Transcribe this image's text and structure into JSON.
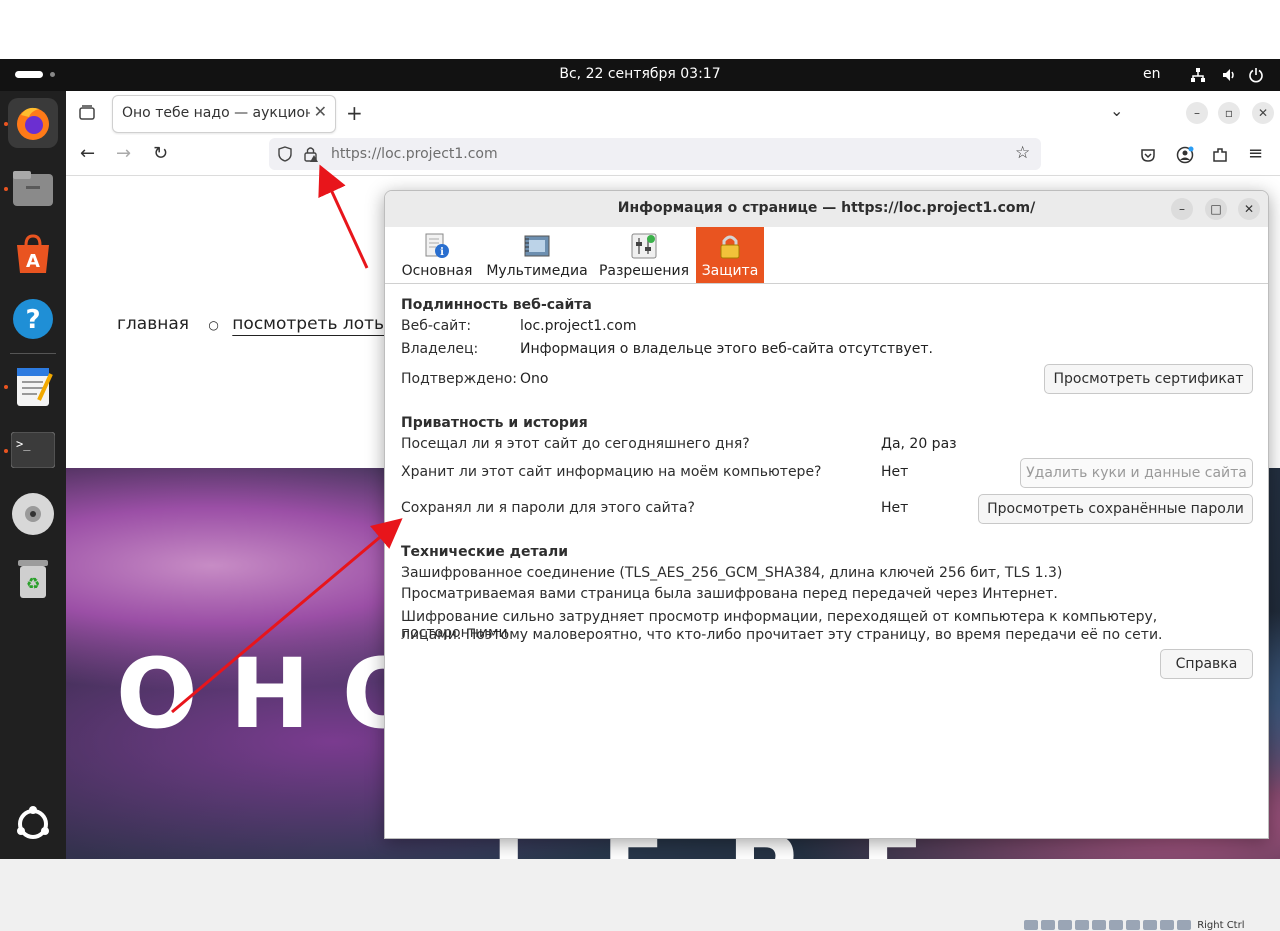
{
  "system": {
    "clock": "Вс, 22 сентября  03:17",
    "language": "en"
  },
  "dock": {
    "items": [
      "firefox",
      "files",
      "app-center",
      "help",
      "text-editor",
      "terminal",
      "optical-drive",
      "trash",
      "show-apps"
    ]
  },
  "browser": {
    "tab_title": "Оно тебе надо — аукцион в",
    "url": "https://loc.project1.com"
  },
  "page": {
    "nav": {
      "home": "главная",
      "lots": "посмотреть лоты"
    },
    "hero_title": "ОНО",
    "hero_subtitle": "ТЕБЕ"
  },
  "dialog": {
    "title": "Информация о странице — https://loc.project1.com/",
    "tabs": [
      "Основная",
      "Мультимедиа",
      "Разрешения",
      "Защита"
    ],
    "active_tab": "Защита",
    "identity": {
      "heading": "Подлинность веб-сайта",
      "website_label": "Веб-сайт:",
      "website_value": "loc.project1.com",
      "owner_label": "Владелец:",
      "owner_value": "Информация о владельце этого веб-сайта отсутствует.",
      "verified_label": "Подтверждено:",
      "verified_value": "Ono",
      "view_cert_button": "Просмотреть сертификат"
    },
    "privacy": {
      "heading": "Приватность и история",
      "visited_q": "Посещал ли я этот сайт до сегодняшнего дня?",
      "visited_a": "Да, 20 раз",
      "stores_q": "Хранит ли этот сайт информацию на моём компьютере?",
      "stores_a": "Нет",
      "clear_cookies_button": "Удалить куки и данные сайта",
      "passwords_q": "Сохранял ли я пароли для этого сайта?",
      "passwords_a": "Нет",
      "view_passwords_button": "Просмотреть сохранённые пароли"
    },
    "technical": {
      "heading": "Технические детали",
      "line1": "Зашифрованное соединение (TLS_AES_256_GCM_SHA384, длина ключей 256 бит, TLS 1.3)",
      "line2": "Просматриваемая вами страница была зашифрована перед передачей через Интернет.",
      "line3": "Шифрование сильно затрудняет просмотр информации, переходящей от компьютера к компьютеру, посторонними",
      "line4": "лицами. Поэтому маловероятно, что кто-либо прочитает эту страницу, во время передачи её по сети.",
      "help_button": "Справка"
    }
  },
  "tray": {
    "label": "Right Ctrl"
  },
  "colors": {
    "accent": "#e95420",
    "annotation_arrow": "#e8151b"
  }
}
